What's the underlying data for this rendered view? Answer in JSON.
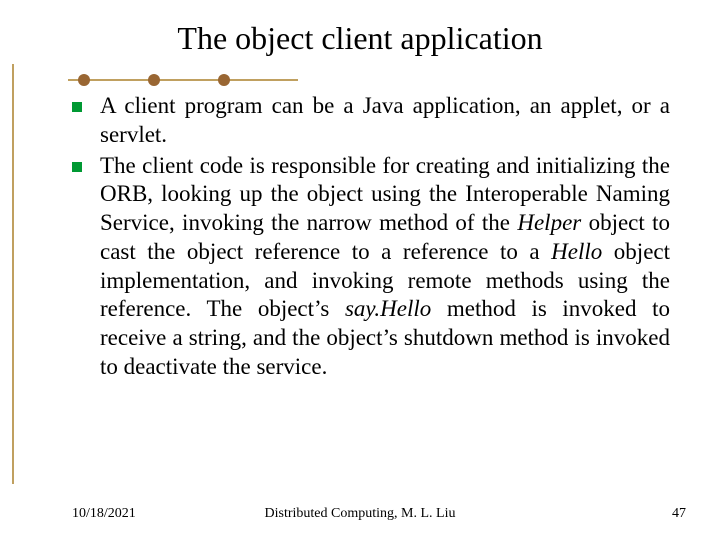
{
  "title": "The object client application",
  "bullets": [
    {
      "segments": [
        {
          "text": "A client program can be a Java application, an applet, or a servlet."
        }
      ]
    },
    {
      "segments": [
        {
          "text": "The client code is responsible for creating and initializing the ORB, looking up the object using the Interoperable Naming Service, invoking the narrow method of the "
        },
        {
          "text": "Helper",
          "italic": true
        },
        {
          "text": " object to cast the object reference to a reference to a "
        },
        {
          "text": "Hello",
          "italic": true
        },
        {
          "text": " object implementation, and invoking remote methods using the reference.  The object’s "
        },
        {
          "text": "say.Hello",
          "italic": true
        },
        {
          "text": " method is invoked to receive a string, and the object’s shutdown method is invoked to deactivate the service."
        }
      ]
    }
  ],
  "footer": {
    "date": "10/18/2021",
    "center": "Distributed Computing, M. L. Liu",
    "page": "47"
  }
}
